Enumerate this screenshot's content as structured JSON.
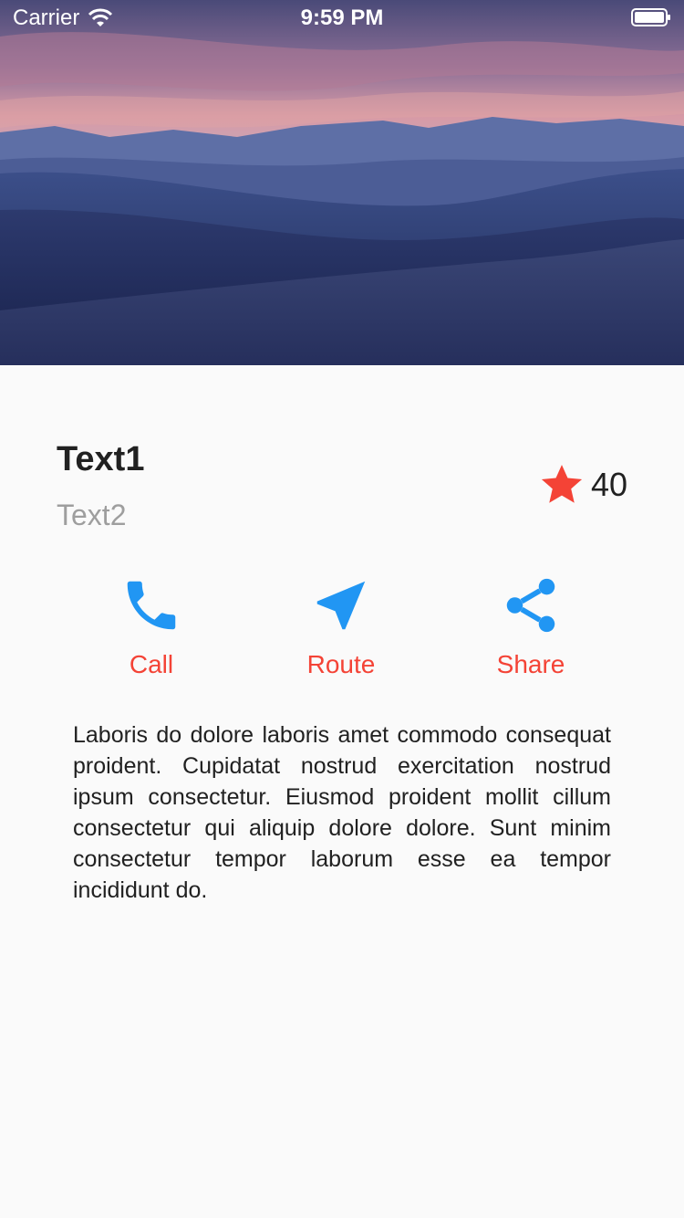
{
  "status_bar": {
    "carrier": "Carrier",
    "time": "9:59 PM"
  },
  "header": {
    "title": "Text1",
    "subtitle": "Text2"
  },
  "rating": {
    "count": "40",
    "star_color": "#f44336"
  },
  "actions": [
    {
      "label": "Call",
      "icon": "phone-icon"
    },
    {
      "label": "Route",
      "icon": "navigation-icon"
    },
    {
      "label": "Share",
      "icon": "share-icon"
    }
  ],
  "colors": {
    "icon": "#2196f3",
    "action_label": "#f44336"
  },
  "description": "Laboris do dolore laboris amet commodo consequat proident. Cupidatat nostrud exercitation nostrud ipsum consectetur. Eiusmod proident mollit cillum consectetur qui aliquip dolore dolore. Sunt minim consectetur tempor laborum esse ea tempor incididunt do."
}
